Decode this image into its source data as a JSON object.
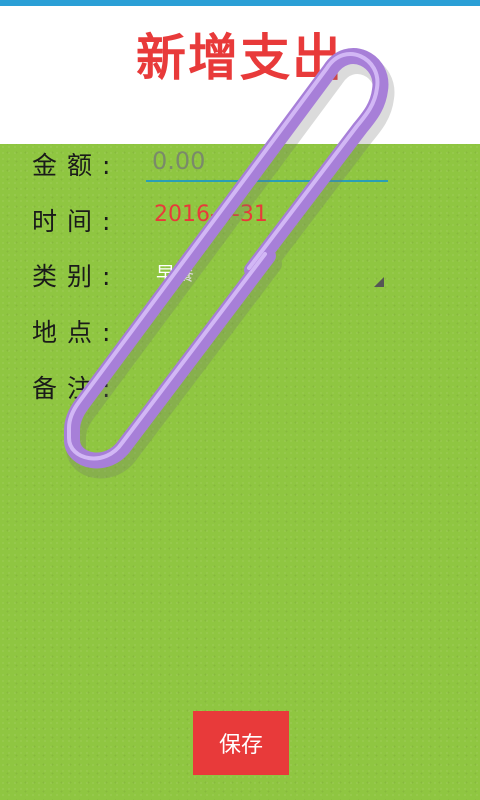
{
  "header": {
    "title": "新增支出"
  },
  "form": {
    "amount": {
      "label": "金额:",
      "value": "",
      "placeholder": "0.00"
    },
    "time": {
      "label": "时间:",
      "value": "2016-8-31"
    },
    "category": {
      "label": "类别:",
      "value": "早餐"
    },
    "location": {
      "label": "地点:",
      "value": ""
    },
    "note": {
      "label": "备注:",
      "value": ""
    }
  },
  "actions": {
    "save_label": "保存"
  },
  "colors": {
    "accent_red": "#e83a3a",
    "paper_green": "#8fc641",
    "input_underline": "#2a9fb5",
    "clip_purple": "#a77fd8"
  },
  "decor": {
    "paperclip": "paperclip-icon"
  }
}
